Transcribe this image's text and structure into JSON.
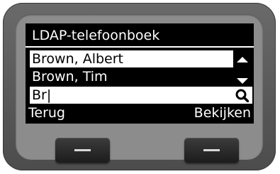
{
  "screen": {
    "title": "LDAP-telefoonboek",
    "list_items": [
      "Brown, Albert",
      "Brown, Tim"
    ],
    "search": {
      "value": "Br|"
    },
    "softkeys": {
      "left": "Terug",
      "right": "Bekijken"
    }
  },
  "icons": {
    "scroll_up": "triangle-up-icon",
    "scroll_down": "triangle-down-icon",
    "search": "magnifier-icon"
  },
  "colors": {
    "screen_bg": "#000000",
    "text_light": "#ffffff",
    "highlight_bg": "#ffffff",
    "device_body": "#5a5a5a",
    "bezel": "#8c8c8c"
  }
}
